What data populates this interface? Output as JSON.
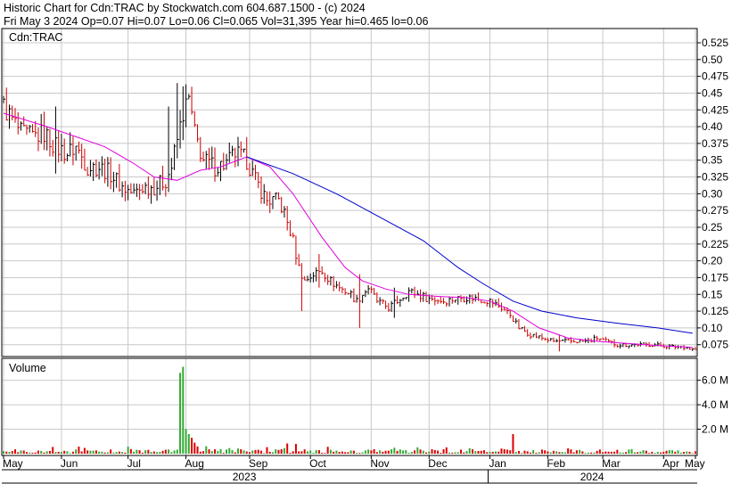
{
  "header": {
    "line1": "Historic Chart for Cdn:TRAC by Stockwatch.com 604.687.1500 - (c) 2024",
    "line2": "Fri May  3 2024   Op=0.07  Hi=0.07  Lo=0.06  Cl=0.065  Vol=31,395  Year hi=0.465  lo=0.06"
  },
  "chart_data": [
    {
      "type": "ohlc",
      "title": "Cdn:TRAC",
      "ylim": [
        0.06,
        0.54
      ],
      "y_ticks": [
        "0.525",
        "0.50",
        "0.475",
        "0.45",
        "0.425",
        "0.40",
        "0.375",
        "0.35",
        "0.325",
        "0.30",
        "0.275",
        "0.25",
        "0.225",
        "0.20",
        "0.175",
        "0.15",
        "0.125",
        "0.10",
        "0.075"
      ],
      "grid": true,
      "x_ticks": [
        "May",
        "Jun",
        "Jul",
        "Aug",
        "Sep",
        "Oct",
        "Nov",
        "Dec",
        "Jan",
        "Feb",
        "Mar",
        "Apr",
        "May"
      ],
      "year_labels": [
        "2023",
        "2024"
      ],
      "up_color": "#000000",
      "down_color": "#cc0000",
      "ma_short_color": "#e000e0",
      "ma_long_color": "#0000cc",
      "anchors": [
        [
          0,
          0.43
        ],
        [
          3,
          0.41
        ],
        [
          6,
          0.39
        ],
        [
          10,
          0.385
        ],
        [
          14,
          0.39
        ],
        [
          18,
          0.37
        ],
        [
          22,
          0.36
        ],
        [
          25,
          0.37
        ],
        [
          29,
          0.34
        ],
        [
          33,
          0.34
        ],
        [
          37,
          0.33
        ],
        [
          41,
          0.31
        ],
        [
          45,
          0.3
        ],
        [
          48,
          0.31
        ],
        [
          52,
          0.31
        ],
        [
          56,
          0.32
        ],
        [
          58,
          0.34
        ],
        [
          62,
          0.42
        ],
        [
          64,
          0.44
        ],
        [
          66,
          0.39
        ],
        [
          69,
          0.35
        ],
        [
          73,
          0.34
        ],
        [
          77,
          0.345
        ],
        [
          80,
          0.36
        ],
        [
          84,
          0.35
        ],
        [
          87,
          0.32
        ],
        [
          91,
          0.29
        ],
        [
          95,
          0.29
        ],
        [
          97,
          0.27
        ],
        [
          100,
          0.23
        ],
        [
          102,
          0.19
        ],
        [
          104,
          0.17
        ],
        [
          107,
          0.18
        ],
        [
          110,
          0.185
        ],
        [
          113,
          0.17
        ],
        [
          116,
          0.16
        ],
        [
          120,
          0.15
        ],
        [
          122,
          0.14
        ],
        [
          126,
          0.16
        ],
        [
          129,
          0.14
        ],
        [
          133,
          0.13
        ],
        [
          136,
          0.14
        ],
        [
          140,
          0.155
        ],
        [
          146,
          0.145
        ],
        [
          152,
          0.14
        ],
        [
          158,
          0.145
        ],
        [
          162,
          0.145
        ],
        [
          168,
          0.14
        ],
        [
          172,
          0.13
        ],
        [
          175,
          0.12
        ],
        [
          178,
          0.1
        ],
        [
          182,
          0.09
        ],
        [
          186,
          0.085
        ],
        [
          190,
          0.08
        ],
        [
          196,
          0.08
        ],
        [
          202,
          0.08
        ],
        [
          205,
          0.085
        ],
        [
          208,
          0.08
        ],
        [
          212,
          0.075
        ],
        [
          218,
          0.075
        ],
        [
          224,
          0.075
        ],
        [
          230,
          0.072
        ],
        [
          235,
          0.072
        ],
        [
          238,
          0.068
        ]
      ],
      "spikes": [
        [
          18,
          0.43,
          0.33
        ],
        [
          57,
          0.43,
          0.35
        ],
        [
          60,
          0.465,
          0.36
        ],
        [
          62,
          0.46,
          0.38
        ],
        [
          103,
          0.19,
          0.125
        ],
        [
          109,
          0.21,
          0.16
        ],
        [
          123,
          0.18,
          0.1
        ],
        [
          135,
          0.16,
          0.115
        ],
        [
          192,
          0.09,
          0.065
        ]
      ],
      "ma_short": [
        [
          0,
          0.42
        ],
        [
          15,
          0.4
        ],
        [
          25,
          0.385
        ],
        [
          35,
          0.37
        ],
        [
          45,
          0.345
        ],
        [
          52,
          0.325
        ],
        [
          60,
          0.32
        ],
        [
          68,
          0.335
        ],
        [
          75,
          0.34
        ],
        [
          84,
          0.355
        ],
        [
          92,
          0.34
        ],
        [
          100,
          0.3
        ],
        [
          110,
          0.235
        ],
        [
          118,
          0.19
        ],
        [
          124,
          0.17
        ],
        [
          132,
          0.158
        ],
        [
          140,
          0.15
        ],
        [
          150,
          0.147
        ],
        [
          160,
          0.145
        ],
        [
          168,
          0.14
        ],
        [
          176,
          0.125
        ],
        [
          185,
          0.1
        ],
        [
          195,
          0.085
        ],
        [
          205,
          0.08
        ],
        [
          215,
          0.077
        ],
        [
          225,
          0.074
        ],
        [
          238,
          0.071
        ]
      ],
      "ma_long": [
        [
          84,
          0.355
        ],
        [
          100,
          0.33
        ],
        [
          115,
          0.3
        ],
        [
          130,
          0.265
        ],
        [
          145,
          0.23
        ],
        [
          157,
          0.19
        ],
        [
          166,
          0.165
        ],
        [
          176,
          0.14
        ],
        [
          186,
          0.125
        ],
        [
          198,
          0.115
        ],
        [
          212,
          0.107
        ],
        [
          226,
          0.1
        ],
        [
          238,
          0.092
        ]
      ]
    },
    {
      "type": "bar",
      "title": "Volume",
      "ylim": [
        0,
        7500000
      ],
      "y_ticks": [
        "6.0 M",
        "4.0 M",
        "2.0 M"
      ],
      "grid": true,
      "spikes": [
        [
          61,
          6.6
        ],
        [
          62,
          7.1
        ],
        [
          63,
          2.0
        ],
        [
          64,
          1.6
        ],
        [
          65,
          1.3
        ],
        [
          66,
          0.9
        ],
        [
          67,
          0.6
        ],
        [
          87,
          0.3
        ],
        [
          101,
          0.8
        ],
        [
          176,
          1.6
        ]
      ]
    }
  ]
}
